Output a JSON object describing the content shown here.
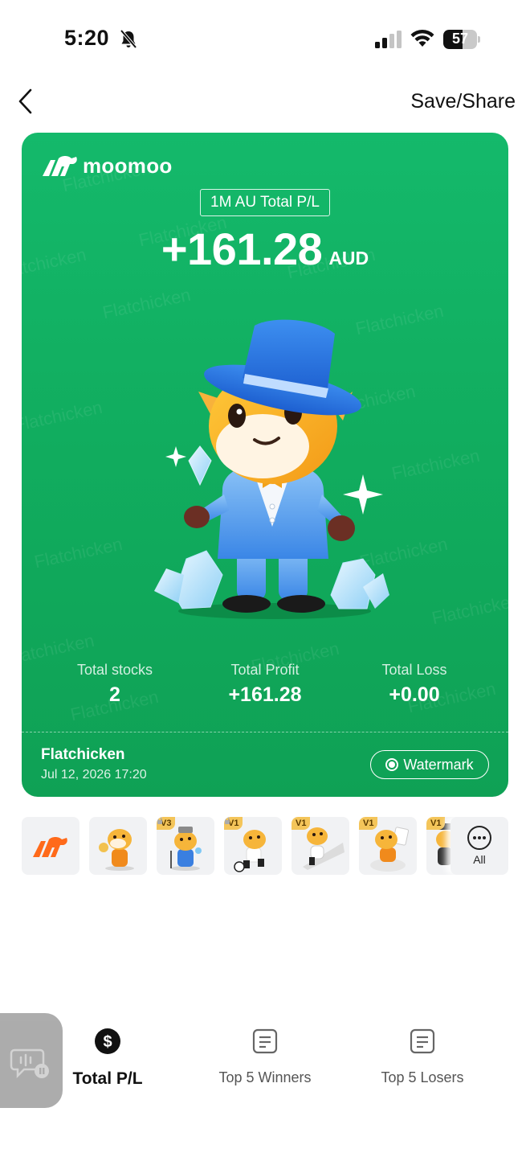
{
  "status_bar": {
    "time": "5:20",
    "battery": "57",
    "battery_level": 0.57
  },
  "nav": {
    "action_label": "Save/Share"
  },
  "card": {
    "brand": "moomoo",
    "period_label": "1M AU Total P/L",
    "pl_value": "+161.28",
    "currency": "AUD",
    "watermark_text": "Flatchicken",
    "stats": {
      "total_stocks_label": "Total stocks",
      "total_stocks_value": "2",
      "total_profit_label": "Total Profit",
      "total_profit_value": "+161.28",
      "total_loss_label": "Total Loss",
      "total_loss_value": "+0.00"
    },
    "user_name": "Flatchicken",
    "date": "Jul 12, 2026 17:20",
    "watermark_toggle_label": "Watermark"
  },
  "themes": {
    "badges": [
      "V3",
      "V1",
      "V1",
      "V1",
      "V1"
    ],
    "all_label": "All"
  },
  "tabs": [
    {
      "label": "Total P/L",
      "active": true
    },
    {
      "label": "Top 5 Winners",
      "active": false
    },
    {
      "label": "Top 5 Losers",
      "active": false
    }
  ],
  "colors": {
    "brand_green": "#11ad5f",
    "accent_orange": "#ff6a1a",
    "text_dark": "#111111"
  }
}
